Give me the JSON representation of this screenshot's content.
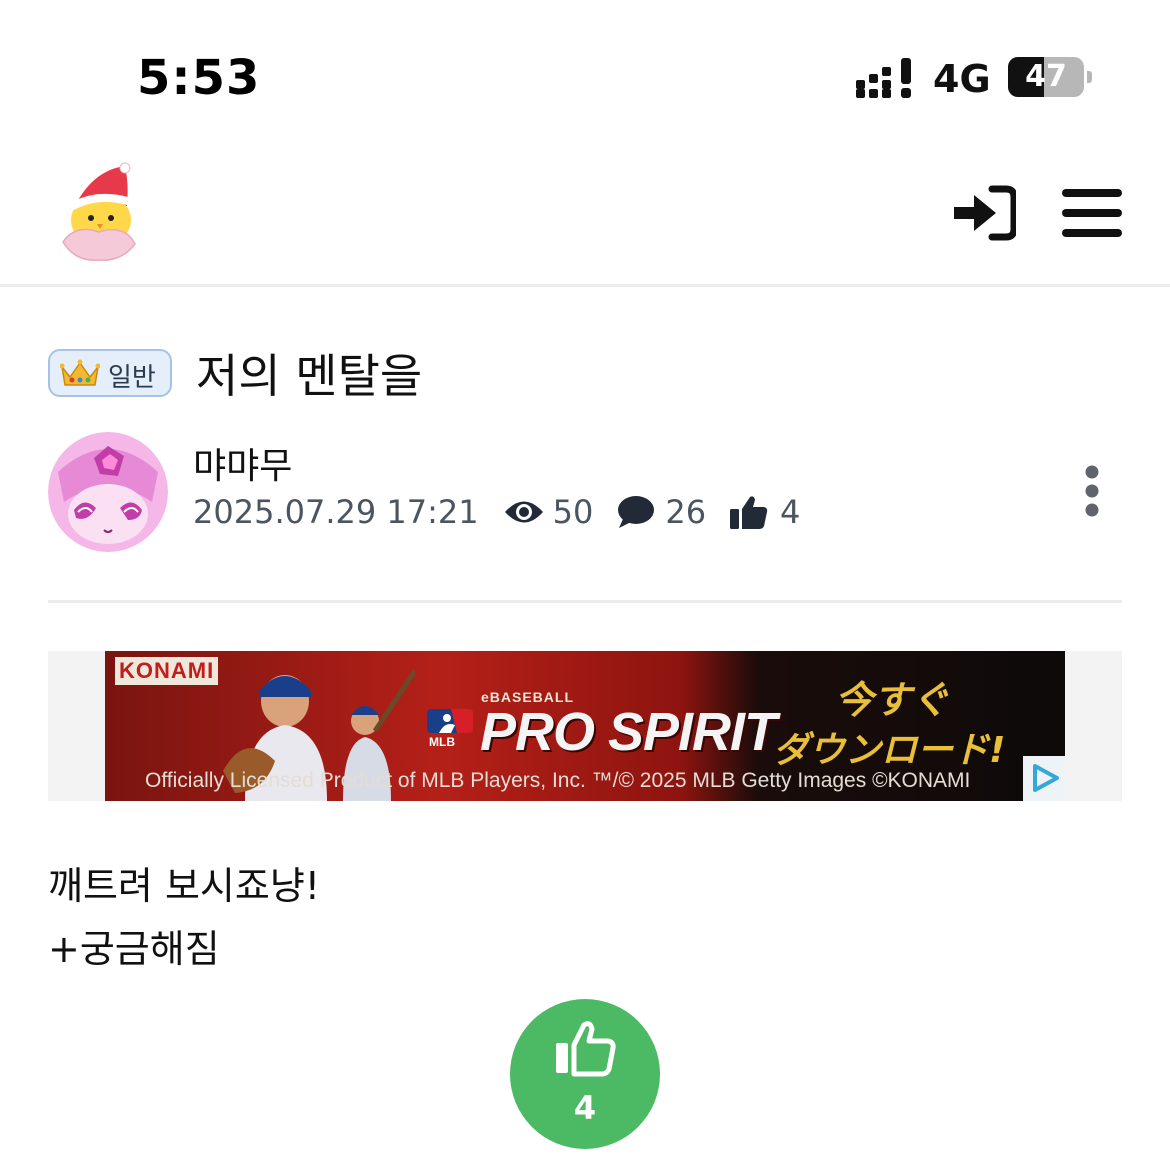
{
  "status_bar": {
    "time": "5:53",
    "network": "4G",
    "battery": "47",
    "battery_level": 0.47,
    "icons": [
      "signal-icon",
      "battery-icon"
    ]
  },
  "header": {
    "logo": "santa-chick-logo",
    "icons": [
      "login-icon",
      "hamburger-menu-icon"
    ]
  },
  "post": {
    "category": "일반",
    "category_icon": "crown-icon",
    "title": "저의 멘탈을",
    "author": "먀먀무",
    "date": "2025.07.29 17:21",
    "views": "50",
    "comments": "26",
    "likes": "4",
    "body_lines": [
      "깨트려 보시죠냥!",
      "+궁금해짐"
    ]
  },
  "ad": {
    "brand": "KONAMI",
    "product": "eBASEBALL",
    "headline": "PRO SPIRIT",
    "league": "MLB",
    "cta_line1": "今すぐ",
    "cta_line2": "ダウンロード!",
    "footer": "Officially Licensed Product of MLB Players, Inc.   ™/© 2025 MLB   Getty Images   ©KONAMI"
  },
  "like_button": {
    "count": "4"
  },
  "colors": {
    "like_green": "#4cb964",
    "badge_bg": "#e4effb",
    "badge_border": "#a6c3e3",
    "meta_text": "#4b5560"
  }
}
